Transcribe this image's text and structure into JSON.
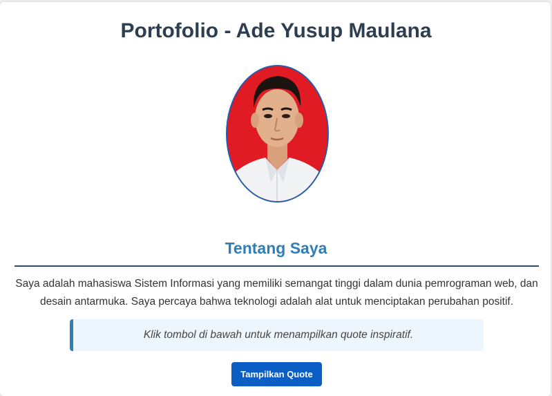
{
  "header": {
    "title": "Portofolio - Ade Yusup Maulana"
  },
  "profile": {
    "photo": "profile-photo"
  },
  "about": {
    "heading": "Tentang Saya",
    "paragraph": "Saya adalah mahasiswa Sistem Informasi yang memiliki semangat tinggi dalam dunia pemrograman web, dan desain antarmuka. Saya percaya bahwa teknologi adalah alat untuk menciptakan perubahan positif."
  },
  "quote": {
    "text": "Klik tombol di bawah untuk menampilkan quote inspiratif.",
    "button_label": "Tampilkan Quote"
  },
  "colors": {
    "title": "#2c3e50",
    "accent": "#2e7fb8",
    "button": "#0b5ec4",
    "photo_background": "#e01b24",
    "photo_border": "#1f5fb0"
  }
}
